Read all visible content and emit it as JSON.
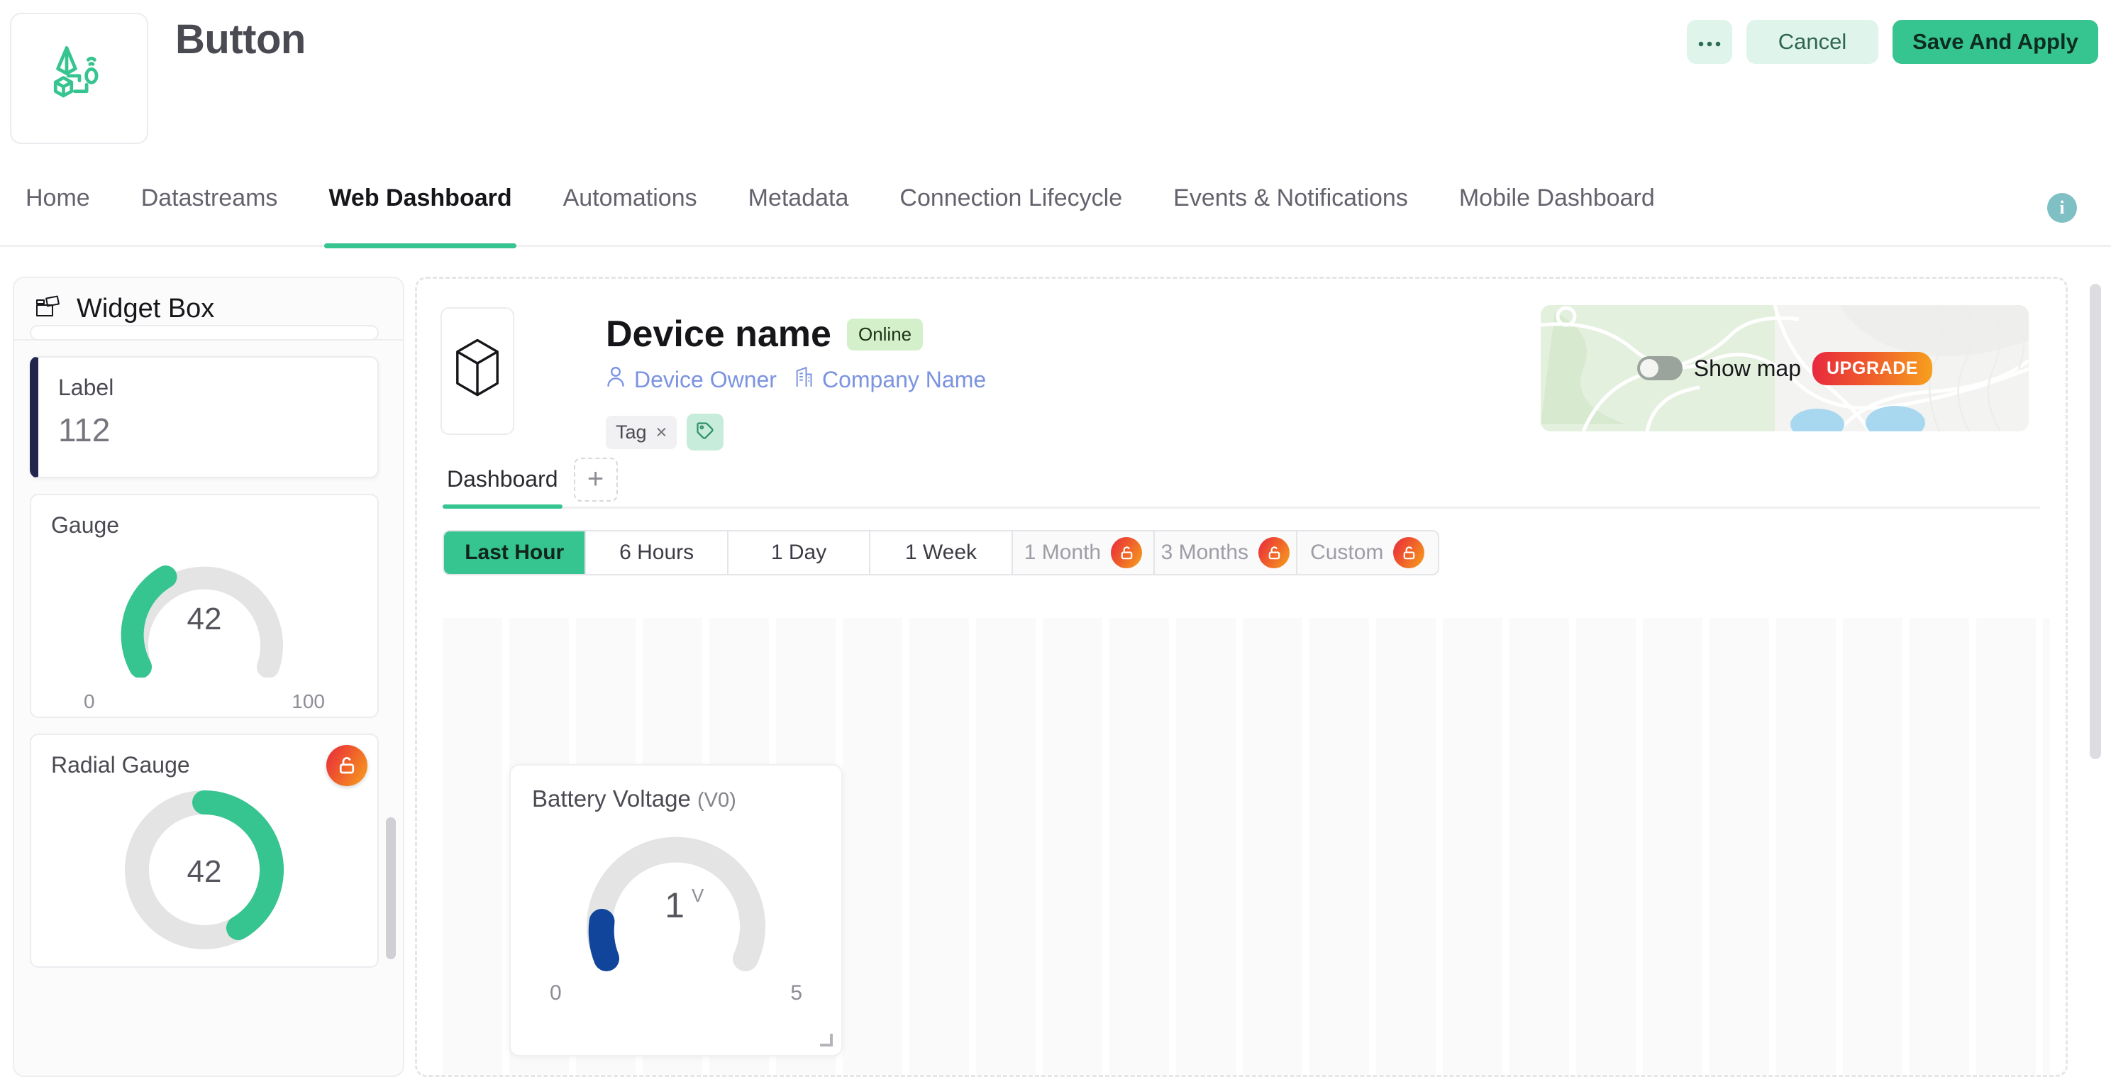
{
  "topbar": {
    "logo_icon": "iot-device-logo-icon",
    "title": "Button",
    "more_label": "●●●",
    "cancel_label": "Cancel",
    "save_label": "Save And Apply"
  },
  "nav": {
    "tabs": [
      {
        "label": "Home",
        "active": false
      },
      {
        "label": "Datastreams",
        "active": false
      },
      {
        "label": "Web Dashboard",
        "active": true
      },
      {
        "label": "Automations",
        "active": false
      },
      {
        "label": "Metadata",
        "active": false
      },
      {
        "label": "Connection Lifecycle",
        "active": false
      },
      {
        "label": "Events & Notifications",
        "active": false
      },
      {
        "label": "Mobile Dashboard",
        "active": false
      }
    ],
    "info_label": "i"
  },
  "sidebar": {
    "header": {
      "icon": "widget-box-icon",
      "title": "Widget Box"
    },
    "widgets": [
      {
        "name": "Label",
        "value": "112",
        "selected": true,
        "locked": false,
        "type": "label"
      },
      {
        "name": "Gauge",
        "value": "42",
        "min": "0",
        "max": "100",
        "selected": false,
        "locked": false,
        "type": "arc-gauge"
      },
      {
        "name": "Radial Gauge",
        "value": "42",
        "selected": false,
        "locked": true,
        "type": "radial-gauge"
      }
    ]
  },
  "device": {
    "thumb_icon": "cube-icon",
    "name": "Device name",
    "status": "Online",
    "owner": {
      "icon": "user-icon",
      "label": "Device Owner"
    },
    "company": {
      "icon": "building-icon",
      "label": "Company Name"
    },
    "tag": {
      "label": "Tag",
      "remove": "×"
    },
    "add_tag_icon": "tag-icon"
  },
  "map": {
    "toggle_on": false,
    "show_map_label": "Show map",
    "upgrade_label": "UPGRADE"
  },
  "dashboard": {
    "tabs": [
      {
        "label": "Dashboard",
        "active": true
      }
    ],
    "add_tab_label": "+",
    "time_ranges": [
      {
        "label": "Last Hour",
        "active": true,
        "locked": false
      },
      {
        "label": "6 Hours",
        "active": false,
        "locked": false
      },
      {
        "label": "1 Day",
        "active": false,
        "locked": false
      },
      {
        "label": "1 Week",
        "active": false,
        "locked": false
      },
      {
        "label": "1 Month",
        "active": false,
        "locked": true
      },
      {
        "label": "3 Months",
        "active": false,
        "locked": true
      },
      {
        "label": "Custom",
        "active": false,
        "locked": true
      }
    ]
  },
  "widget": {
    "title": "Battery Voltage",
    "datastream": "(V0)",
    "value": "1",
    "unit": "V",
    "min": "0",
    "max": "5"
  },
  "colors": {
    "accent_green": "#36c490",
    "accent_green_soft": "#dff4ea",
    "status_green_bg": "#d4f0cb",
    "link_blue": "#7b93e0",
    "lock_gradient_start": "#e8283f",
    "lock_gradient_end": "#f7a11e",
    "gauge_blue": "#10459b",
    "selected_bar": "#22254e",
    "track_grey": "#e4e4e4"
  },
  "chart_data": [
    {
      "type": "gauge",
      "title": "Gauge",
      "value": 42,
      "min": 0,
      "max": 100,
      "style": "semi-arc",
      "color": "#36c490",
      "track_color": "#e4e4e4",
      "location": "sidebar"
    },
    {
      "type": "gauge",
      "title": "Radial Gauge",
      "value": 42,
      "min": 0,
      "max": 100,
      "style": "full-ring",
      "color": "#36c490",
      "track_color": "#e4e4e4",
      "location": "sidebar"
    },
    {
      "type": "gauge",
      "title": "Battery Voltage",
      "subtitle": "(V0)",
      "value": 1,
      "unit": "V",
      "min": 0,
      "max": 5,
      "style": "semi-arc",
      "color": "#10459b",
      "track_color": "#e4e4e4",
      "location": "dashboard-canvas"
    }
  ]
}
